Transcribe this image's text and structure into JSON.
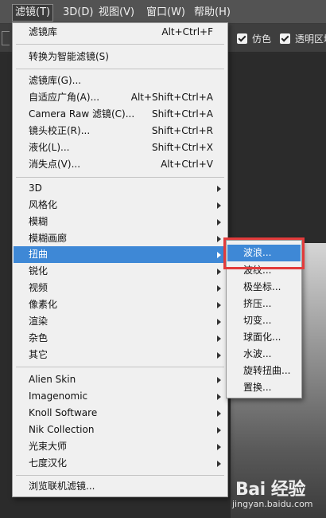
{
  "menubar": {
    "items": [
      "帮助(H)"
    ],
    "visible": [
      "滤镜(T)",
      "3D(D)",
      "视图(V)",
      "窗口(W)",
      "帮助(H)"
    ]
  },
  "options_bar": {
    "antialias_label": "仿色",
    "transparency_label": "透明区域"
  },
  "filter_menu": {
    "items": [
      {
        "label": "滤镜库",
        "shortcut": "Alt+Ctrl+F"
      },
      {
        "label": "转换为智能滤镜(S)",
        "shortcut": ""
      },
      {
        "label": "滤镜库(G)...",
        "shortcut": ""
      },
      {
        "label": "自适应广角(A)...",
        "shortcut": "Alt+Shift+Ctrl+A"
      },
      {
        "label": "Camera Raw 滤镜(C)...",
        "shortcut": "Shift+Ctrl+A"
      },
      {
        "label": "镜头校正(R)...",
        "shortcut": "Shift+Ctrl+R"
      },
      {
        "label": "液化(L)...",
        "shortcut": "Shift+Ctrl+X"
      },
      {
        "label": "消失点(V)...",
        "shortcut": "Alt+Ctrl+V"
      },
      {
        "label": "3D",
        "shortcut": ""
      },
      {
        "label": "风格化",
        "shortcut": ""
      },
      {
        "label": "模糊",
        "shortcut": ""
      },
      {
        "label": "模糊画廊",
        "shortcut": ""
      },
      {
        "label": "扭曲",
        "shortcut": ""
      },
      {
        "label": "锐化",
        "shortcut": ""
      },
      {
        "label": "视频",
        "shortcut": ""
      },
      {
        "label": "像素化",
        "shortcut": ""
      },
      {
        "label": "渲染",
        "shortcut": ""
      },
      {
        "label": "杂色",
        "shortcut": ""
      },
      {
        "label": "其它",
        "shortcut": ""
      },
      {
        "label": "Alien Skin",
        "shortcut": ""
      },
      {
        "label": "Imagenomic",
        "shortcut": ""
      },
      {
        "label": "Knoll Software",
        "shortcut": ""
      },
      {
        "label": "Nik Collection",
        "shortcut": ""
      },
      {
        "label": "光束大师",
        "shortcut": ""
      },
      {
        "label": "七度汉化",
        "shortcut": ""
      },
      {
        "label": "浏览联机滤镜...",
        "shortcut": ""
      }
    ]
  },
  "distort_submenu": {
    "items": [
      "波浪...",
      "波纹...",
      "极坐标...",
      "挤压...",
      "切变...",
      "球面化...",
      "水波...",
      "旋转扭曲...",
      "置换..."
    ]
  },
  "watermark": {
    "brand": "Bai 经验",
    "url": "jingyan.baidu.com"
  },
  "colors": {
    "highlight": "#3e88d6",
    "menu_bg": "#f0f0f0",
    "callout": "#e23b3b"
  }
}
